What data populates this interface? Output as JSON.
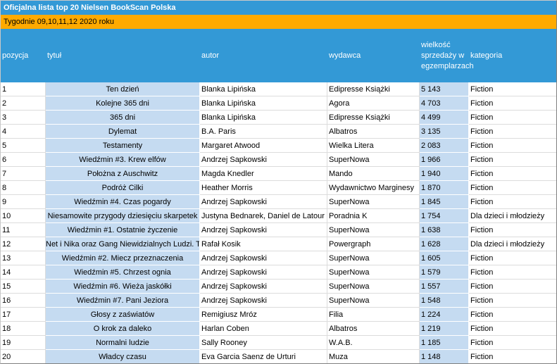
{
  "title": "Oficjalna lista top 20 Nielsen BookScan Polska",
  "subtitle": "Tygodnie 09,10,11,12 2020 roku",
  "colors": {
    "header_blue": "#3399d6",
    "subtitle_orange": "#ffaa00",
    "column_highlight": "#c5dbf1"
  },
  "headers": {
    "pozycja": "pozycja",
    "tytul": "tytuł",
    "autor": "autor",
    "wydawca": "wydawca",
    "sprzedaz": "wielkość sprzedaży w egzemplarzach",
    "kategoria": "kategoria"
  },
  "rows": [
    {
      "pozycja": "1",
      "tytul": "Ten dzień",
      "autor": "Blanka Lipińska",
      "wydawca": "Edipresse Książki",
      "sprzedaz": "5 143",
      "kategoria": "Fiction"
    },
    {
      "pozycja": "2",
      "tytul": "Kolejne 365 dni",
      "autor": "Blanka Lipińska",
      "wydawca": "Agora",
      "sprzedaz": "4 703",
      "kategoria": "Fiction"
    },
    {
      "pozycja": "3",
      "tytul": "365 dni",
      "autor": "Blanka Lipińska",
      "wydawca": "Edipresse Książki",
      "sprzedaz": "4 499",
      "kategoria": "Fiction"
    },
    {
      "pozycja": "4",
      "tytul": "Dylemat",
      "autor": "B.A. Paris",
      "wydawca": "Albatros",
      "sprzedaz": "3 135",
      "kategoria": "Fiction"
    },
    {
      "pozycja": "5",
      "tytul": "Testamenty",
      "autor": "Margaret Atwood",
      "wydawca": "Wielka Litera",
      "sprzedaz": "2 083",
      "kategoria": "Fiction"
    },
    {
      "pozycja": "6",
      "tytul": "Wiedźmin #3. Krew elfów",
      "autor": "Andrzej Sapkowski",
      "wydawca": "SuperNowa",
      "sprzedaz": "1 966",
      "kategoria": "Fiction"
    },
    {
      "pozycja": "7",
      "tytul": "Położna z Auschwitz",
      "autor": "Magda Knedler",
      "wydawca": "Mando",
      "sprzedaz": "1 940",
      "kategoria": "Fiction"
    },
    {
      "pozycja": "8",
      "tytul": "Podróż Cilki",
      "autor": "Heather Morris",
      "wydawca": "Wydawnictwo Marginesy",
      "sprzedaz": "1 870",
      "kategoria": "Fiction"
    },
    {
      "pozycja": "9",
      "tytul": "Wiedźmin #4. Czas pogardy",
      "autor": "Andrzej Sapkowski",
      "wydawca": "SuperNowa",
      "sprzedaz": "1 845",
      "kategoria": "Fiction"
    },
    {
      "pozycja": "10",
      "tytul": "Niesamowite przygody dziesięciu skarpetek",
      "autor": "Justyna Bednarek, Daniel de Latour",
      "wydawca": "Poradnia K",
      "sprzedaz": "1 754",
      "kategoria": "Dla dzieci i młodzieży"
    },
    {
      "pozycja": "11",
      "tytul": "Wiedźmin #1. Ostatnie życzenie",
      "autor": "Andrzej Sapkowski",
      "wydawca": "SuperNowa",
      "sprzedaz": "1 638",
      "kategoria": "Fiction"
    },
    {
      "pozycja": "12",
      "tytul": "Net i Nika oraz Gang Niewidzialnych Ludzi. T",
      "autor": "Rafał Kosik",
      "wydawca": "Powergraph",
      "sprzedaz": "1 628",
      "kategoria": "Dla dzieci i młodzieży"
    },
    {
      "pozycja": "13",
      "tytul": "Wiedźmin #2. Miecz przeznaczenia",
      "autor": "Andrzej Sapkowski",
      "wydawca": "SuperNowa",
      "sprzedaz": "1 605",
      "kategoria": "Fiction"
    },
    {
      "pozycja": "14",
      "tytul": "Wiedźmin #5. Chrzest ognia",
      "autor": "Andrzej Sapkowski",
      "wydawca": "SuperNowa",
      "sprzedaz": "1 579",
      "kategoria": "Fiction"
    },
    {
      "pozycja": "15",
      "tytul": "Wiedźmin #6. Wieża jaskółki",
      "autor": "Andrzej Sapkowski",
      "wydawca": "SuperNowa",
      "sprzedaz": "1 557",
      "kategoria": "Fiction"
    },
    {
      "pozycja": "16",
      "tytul": "Wiedźmin #7. Pani Jeziora",
      "autor": "Andrzej Sapkowski",
      "wydawca": "SuperNowa",
      "sprzedaz": "1 548",
      "kategoria": "Fiction"
    },
    {
      "pozycja": "17",
      "tytul": "Głosy z zaświatów",
      "autor": "Remigiusz Mróz",
      "wydawca": "Filia",
      "sprzedaz": "1 224",
      "kategoria": "Fiction"
    },
    {
      "pozycja": "18",
      "tytul": "O krok za daleko",
      "autor": "Harlan Coben",
      "wydawca": "Albatros",
      "sprzedaz": "1 219",
      "kategoria": "Fiction"
    },
    {
      "pozycja": "19",
      "tytul": "Normalni ludzie",
      "autor": "Sally Rooney",
      "wydawca": "W.A.B.",
      "sprzedaz": "1 185",
      "kategoria": "Fiction"
    },
    {
      "pozycja": "20",
      "tytul": "Władcy czasu",
      "autor": "Eva Garcia Saenz de Urturi",
      "wydawca": "Muza",
      "sprzedaz": "1 148",
      "kategoria": "Fiction"
    }
  ]
}
